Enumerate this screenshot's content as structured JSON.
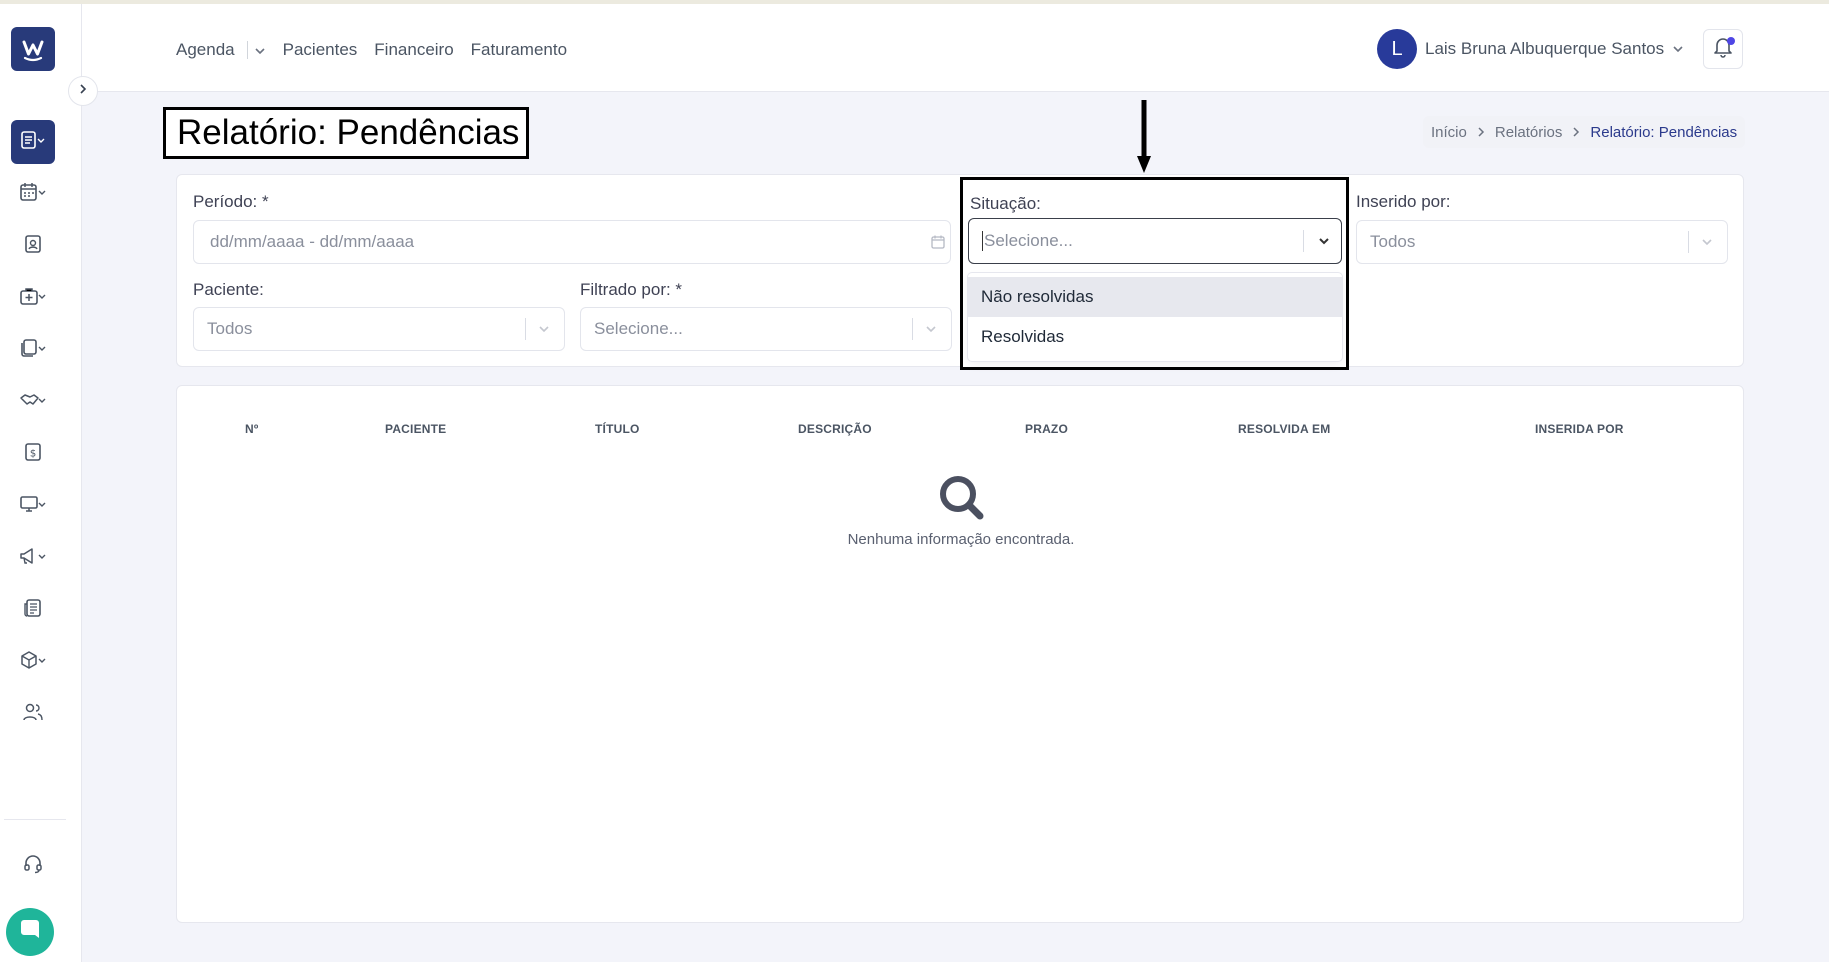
{
  "header": {
    "nav": [
      {
        "label": "Agenda"
      },
      {
        "label": "Pacientes"
      },
      {
        "label": "Financeiro"
      },
      {
        "label": "Faturamento"
      }
    ],
    "user": {
      "initial": "L",
      "name": "Lais Bruna Albuquerque Santos"
    }
  },
  "page": {
    "title": "Relatório: Pendências",
    "breadcrumb": [
      "Início",
      "Relatórios",
      "Relatório: Pendências"
    ]
  },
  "filters": {
    "periodo": {
      "label": "Período: *",
      "placeholder": "dd/mm/aaaa - dd/mm/aaaa"
    },
    "situacao": {
      "label": "Situação:",
      "placeholder": "Selecione...",
      "options": [
        "Não resolvidas",
        "Resolvidas"
      ]
    },
    "inserido_por": {
      "label": "Inserido por:",
      "value": "Todos"
    },
    "paciente": {
      "label": "Paciente:",
      "value": "Todos"
    },
    "filtrado_por": {
      "label": "Filtrado por: *",
      "value": "Selecione..."
    }
  },
  "table": {
    "columns": [
      "Nº",
      "PACIENTE",
      "TÍTULO",
      "DESCRIÇÃO",
      "PRAZO",
      "RESOLVIDA EM",
      "INSERIDA POR"
    ],
    "empty_message": "Nenhuma informação encontrada."
  },
  "sidebar": {
    "items": [
      "reports-icon",
      "calendar-icon",
      "patient-badge-icon",
      "medical-kit-icon",
      "documents-icon",
      "handshake-icon",
      "billing-icon",
      "monitor-icon",
      "megaphone-icon",
      "newspaper-icon",
      "package-icon",
      "users-icon",
      "headset-icon"
    ]
  }
}
